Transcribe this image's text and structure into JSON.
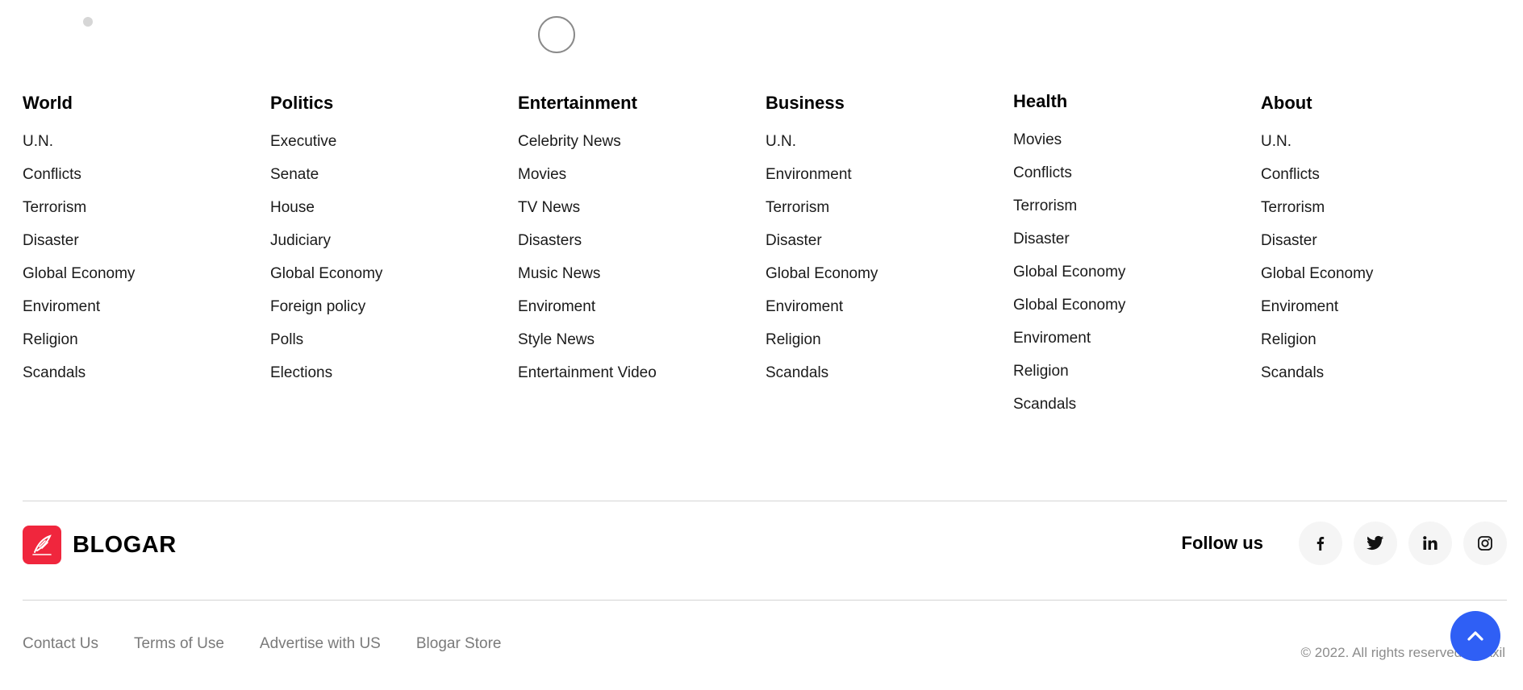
{
  "columns": [
    {
      "title": "World",
      "items": [
        "U.N.",
        "Conflicts",
        "Terrorism",
        "Disaster",
        "Global Economy",
        "Enviroment",
        "Religion",
        "Scandals"
      ]
    },
    {
      "title": "Politics",
      "items": [
        "Executive",
        "Senate",
        "House",
        "Judiciary",
        "Global Economy",
        "Foreign policy",
        "Polls",
        "Elections"
      ]
    },
    {
      "title": "Entertainment",
      "items": [
        "Celebrity News",
        "Movies",
        "TV News",
        "Disasters",
        "Music News",
        "Enviroment",
        "Style News",
        "Entertainment Video"
      ]
    },
    {
      "title": "Business",
      "items": [
        "U.N.",
        "Environment",
        "Terrorism",
        "Disaster",
        "Global Economy",
        "Enviroment",
        "Religion",
        "Scandals"
      ]
    },
    {
      "title": "Health",
      "items": [
        "Movies",
        "Conflicts",
        "Terrorism",
        "Disaster",
        "Global Economy",
        "Global Economy",
        "Enviroment",
        "Religion",
        "Scandals"
      ]
    },
    {
      "title": "About",
      "items": [
        "U.N.",
        "Conflicts",
        "Terrorism",
        "Disaster",
        "Global Economy",
        "Enviroment",
        "Religion",
        "Scandals"
      ]
    }
  ],
  "brand": {
    "name": "BLOGAR",
    "logo_icon": "feather-pen-icon",
    "logo_color": "#f0263d"
  },
  "follow": {
    "label": "Follow us",
    "socials": [
      "facebook-icon",
      "twitter-icon",
      "linkedin-icon",
      "instagram-icon"
    ]
  },
  "bottom_links": [
    "Contact Us",
    "Terms of Use",
    "Advertise with US",
    "Blogar Store"
  ],
  "copyright": "© 2022. All rights reserved by Axil",
  "scroll_top": {
    "icon": "chevron-up-icon",
    "color": "#2f5ff5"
  }
}
